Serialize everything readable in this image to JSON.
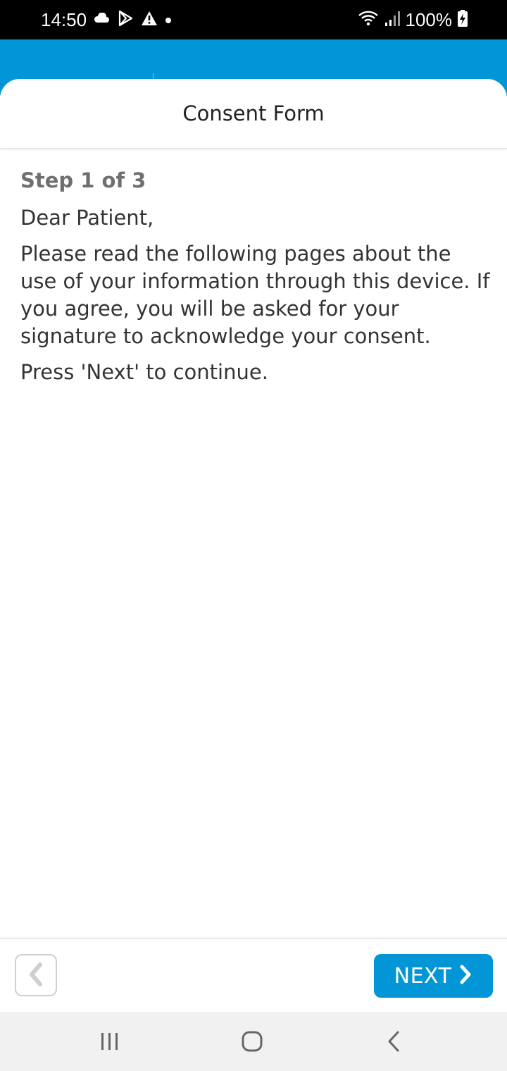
{
  "status_bar": {
    "time": "14:50",
    "left_icons": [
      "cloud-icon",
      "play-store-icon",
      "warning-icon",
      "dot-icon"
    ],
    "right_icons": [
      "wifi-icon",
      "signal-icon",
      "battery-charging-icon"
    ],
    "battery": "100%"
  },
  "colors": {
    "accent": "#0396d6",
    "text": "#333333",
    "step_label": "#6f6f6f",
    "nav_bar_bg": "#f1f1f1"
  },
  "sheet": {
    "title": "Consent Form"
  },
  "content": {
    "step": "Step 1 of 3",
    "greeting": "Dear Patient,",
    "body": "Please read the following pages about the use of your information through this device. If you agree, you will be asked for your signature to acknowledge your consent.",
    "instruction": "Press 'Next' to continue."
  },
  "actions": {
    "back_icon": "chevron-left-icon",
    "next_label": "NEXT",
    "next_icon": "chevron-right-icon"
  },
  "nav_bar": {
    "icons": [
      "recent-apps-icon",
      "home-icon",
      "back-icon"
    ]
  }
}
